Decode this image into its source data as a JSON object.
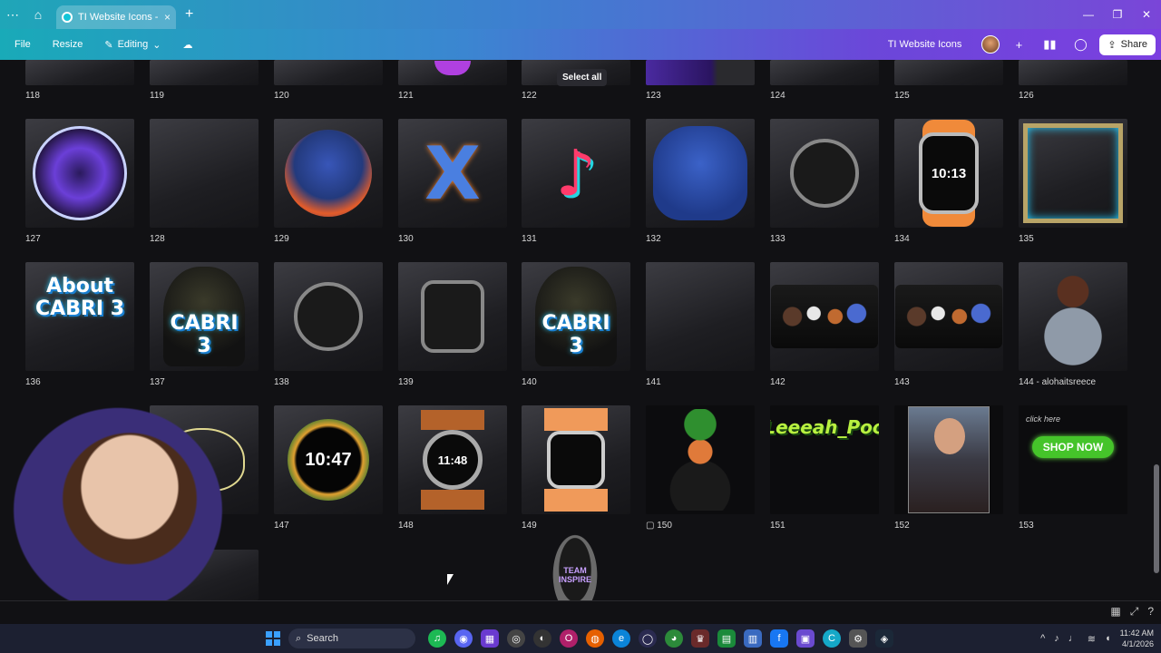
{
  "browser": {
    "tab_title": "TI Website Icons - ...",
    "tab_close": "×",
    "new_tab": "+",
    "menu_dots": "⋯",
    "win_minimize": "—",
    "win_restore": "❐",
    "win_close": "✕"
  },
  "editor": {
    "file": "File",
    "resize": "Resize",
    "editing": "Editing",
    "doc_title": "TI Website Icons",
    "share": "Share"
  },
  "canvas": {
    "select_all": "Select all",
    "row0_labels": [
      "118",
      "119",
      "120",
      "121",
      "122",
      "123",
      "124",
      "125",
      "126"
    ],
    "row1_labels": [
      "127",
      "128",
      "129",
      "130",
      "131",
      "132",
      "133",
      "134",
      "135"
    ],
    "row2_labels": [
      "136",
      "137",
      "138",
      "139",
      "140",
      "141",
      "142",
      "143",
      "144 - alohaitsreece"
    ],
    "row3_labels": [
      "147",
      "148",
      "149",
      "150",
      "151",
      "152",
      "153"
    ],
    "art": {
      "cabri_about": "About CABRI 3",
      "cabri": "CABRI 3",
      "watch_134_time": "10:13",
      "watch_147_time": "10:47",
      "watch_148_time": "11:48",
      "tiktok_glyph": "♪",
      "x_glyph": "X",
      "leeeah": "Leeeah_Poo",
      "shop_now": "SHOP NOW",
      "click_here": "click here",
      "team_inspire": "TEAM INSPIRE"
    }
  },
  "taskbar": {
    "search": "Search",
    "time": "11:42 AM",
    "date": "4/1/2026"
  },
  "colors": {
    "accent_teal": "#19aab8",
    "accent_purple": "#7b3fe0",
    "shop_green": "#45c42a"
  }
}
